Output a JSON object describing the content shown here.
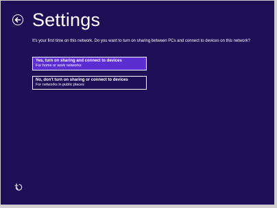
{
  "page": {
    "title": "Settings",
    "description": "It's your first time on this network. Do you want to turn on sharing between PCs and connect to devices on this network?"
  },
  "icons": {
    "back": "back-arrow-circle-icon",
    "ease_of_access": "ease-of-access-icon"
  },
  "options": [
    {
      "title": "Yes, turn on sharing and connect to devices",
      "subtitle": "For home or work networks",
      "selected": true
    },
    {
      "title": "No, don't turn on sharing or connect to devices",
      "subtitle": "For networks in public places",
      "selected": false
    }
  ],
  "colors": {
    "background": "#1e0f57",
    "selected_option": "#5c2dd0",
    "text": "#ffffff"
  }
}
